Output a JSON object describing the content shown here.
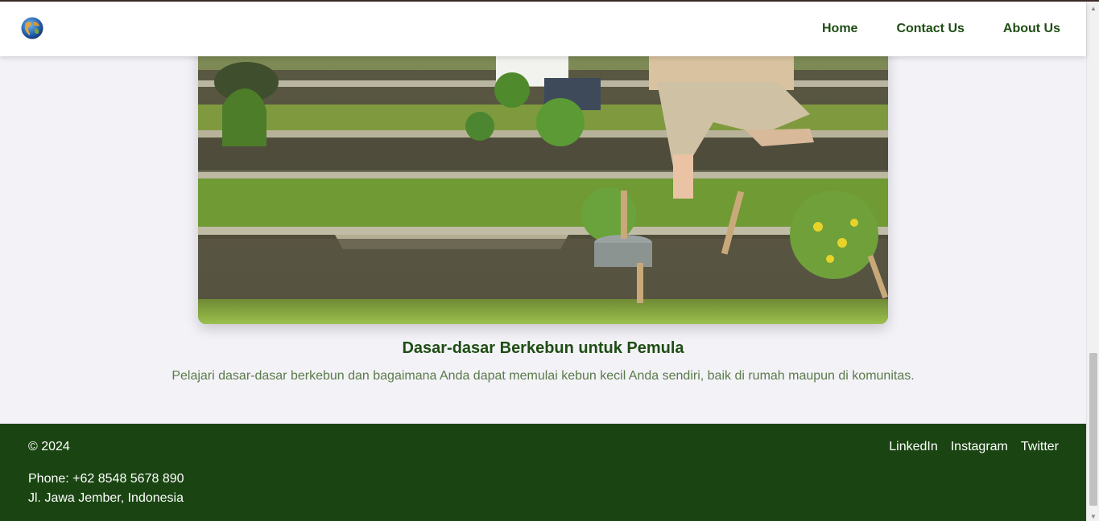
{
  "nav": {
    "logo_icon": "globe-icon",
    "links": [
      "Home",
      "Contact Us",
      "About Us"
    ]
  },
  "article": {
    "image_icon": "garden-photo",
    "title": "Dasar-dasar Berkebun untuk Pemula",
    "description": "Pelajari dasar-dasar berkebun dan bagaimana Anda dapat memulai kebun kecil Anda sendiri, baik di rumah maupun di komunitas."
  },
  "footer": {
    "copyright": "© 2024",
    "phone": "Phone: +62 8548 5678 890",
    "address": "Jl. Jawa Jember, Indonesia",
    "social": [
      "LinkedIn",
      "Instagram",
      "Twitter"
    ]
  },
  "colors": {
    "brand_green": "#1e4d14",
    "footer_bg": "#1a4512",
    "page_bg": "#f3f2f7",
    "muted_text": "#5a7a4a"
  },
  "scrollbar": {
    "up_icon": "triangle-up-icon",
    "down_icon": "triangle-down-icon"
  }
}
